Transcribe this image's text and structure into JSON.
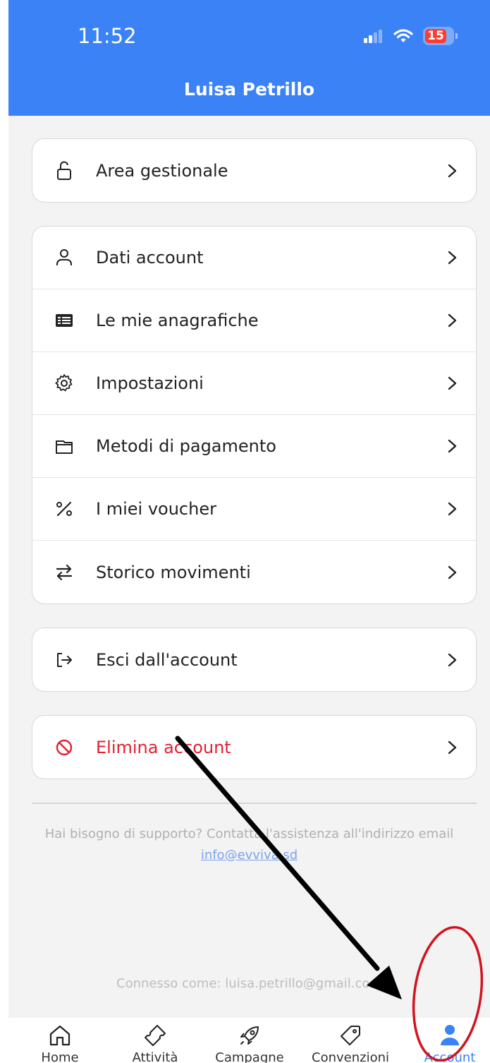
{
  "status": {
    "time": "11:52",
    "battery": "15"
  },
  "header": {
    "title": "Luisa Petrillo"
  },
  "sections": {
    "area": {
      "icon": "unlock-icon",
      "label": "Area gestionale"
    },
    "account_items": [
      {
        "icon": "user-icon",
        "label": "Dati account"
      },
      {
        "icon": "list-card-icon",
        "label": "Le mie anagrafiche"
      },
      {
        "icon": "gear-icon",
        "label": "Impostazioni"
      },
      {
        "icon": "wallet-icon",
        "label": "Metodi di pagamento"
      },
      {
        "icon": "percent-icon",
        "label": "I miei voucher"
      },
      {
        "icon": "swap-arrows-icon",
        "label": "Storico movimenti"
      }
    ],
    "logout": {
      "icon": "logout-icon",
      "label": "Esci dall'account"
    },
    "delete": {
      "icon": "prohibited-icon",
      "label": "Elimina account",
      "color": "#e0212f"
    }
  },
  "support": {
    "text": "Hai bisogno di supporto? Contatta l'assistenza all'indirizzo email",
    "email": "info@evviva.sd"
  },
  "connected": {
    "text": "Connesso come: luisa.petrillo@gmail.com"
  },
  "tabs": [
    {
      "icon": "home-icon",
      "label": "Home"
    },
    {
      "icon": "ticket-icon",
      "label": "Attività"
    },
    {
      "icon": "rocket-icon",
      "label": "Campagne"
    },
    {
      "icon": "tag-icon",
      "label": "Convenzioni"
    },
    {
      "icon": "account-icon",
      "label": "Account",
      "active": true
    }
  ],
  "colors": {
    "primary": "#3b82f6",
    "danger": "#e0212f",
    "annotation_circle": "#d1141e",
    "annotation_arrow": "#000000"
  }
}
